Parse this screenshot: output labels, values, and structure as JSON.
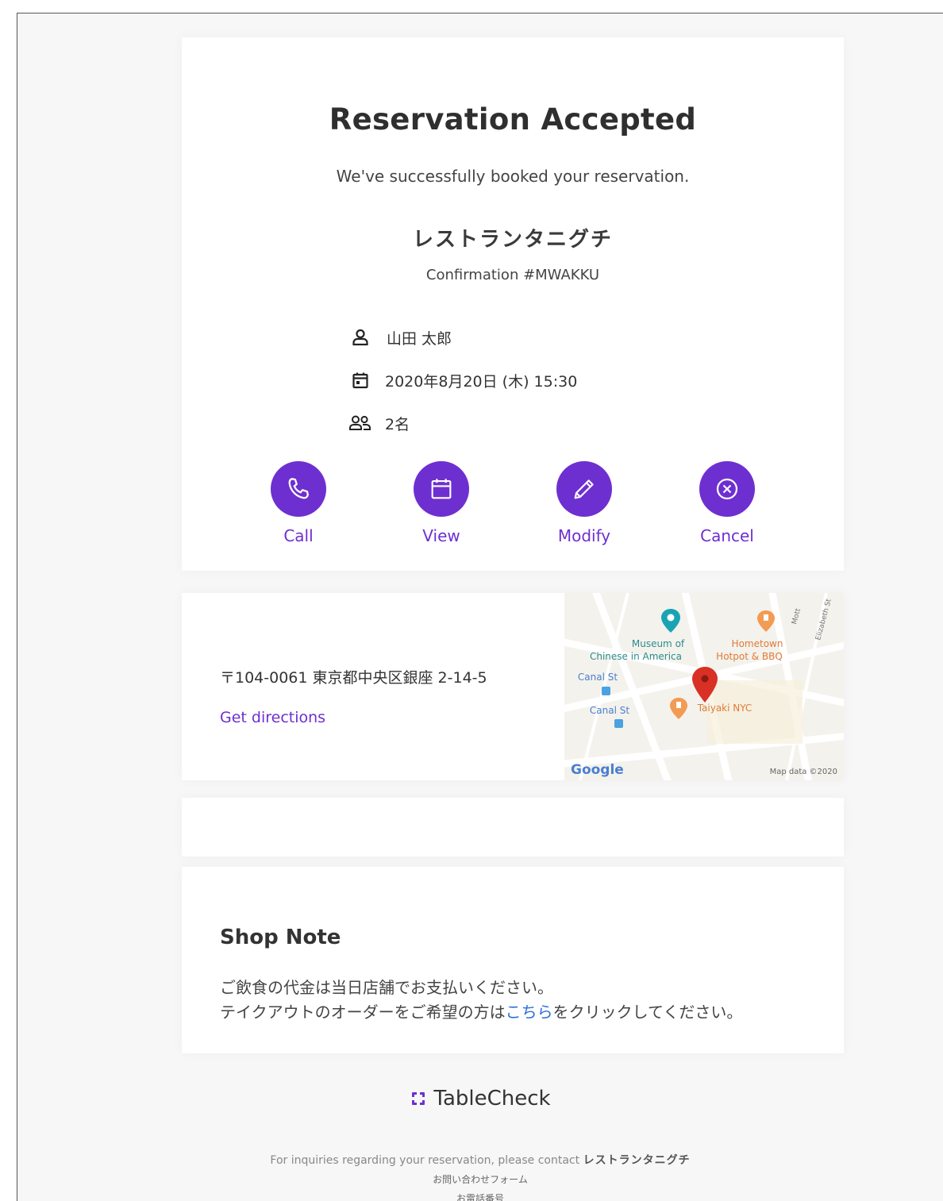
{
  "header": {
    "title": "Reservation Accepted",
    "subtitle": "We've successfully booked your reservation.",
    "restaurant_name": "レストランタニグチ",
    "confirmation": "Confirmation #MWAKKU"
  },
  "details": {
    "guest_name": "山田 太郎",
    "datetime": "2020年8月20日 (木) 15:30",
    "party_size": "2名"
  },
  "actions": [
    {
      "label": "Call",
      "icon": "phone-icon"
    },
    {
      "label": "View",
      "icon": "calendar-icon"
    },
    {
      "label": "Modify",
      "icon": "pencil-icon"
    },
    {
      "label": "Cancel",
      "icon": "close-circle-icon"
    }
  ],
  "location": {
    "address": "〒104-0061 東京都中央区銀座 2-14-5",
    "directions_label": "Get directions",
    "map": {
      "labels": {
        "museum_1": "Museum of",
        "museum_2": "Chinese in America",
        "hotpot_1": "Hometown",
        "hotpot_2": "Hotpot & BBQ",
        "canal_1": "Canal St",
        "canal_2": "Canal St",
        "taiyaki": "Taiyaki NYC",
        "mott": "Mott",
        "elizabeth": "Elizabeth St",
        "google": "Google",
        "mapdata": "Map data ©2020"
      }
    }
  },
  "shop_note": {
    "title": "Shop Note",
    "line1": "ご飲食の代金は当日店舗でお支払いください。",
    "line2_pre": "テイクアウトのオーダーをご希望の方は",
    "line2_link": "こちら",
    "line2_post": "をクリックしてください。"
  },
  "footer": {
    "brand": "TableCheck",
    "inquiry_text": "For inquiries regarding your reservation, please contact",
    "inquiry_restaurant": "レストランタニグチ",
    "contact_form": "お問い合わせフォーム",
    "phone": "お電話番号"
  },
  "colors": {
    "accent": "#6e2fd1",
    "link_blue": "#2f6fd8",
    "map_pin_red": "#d93025",
    "map_orange": "#f29b54",
    "map_teal": "#19a3b5"
  }
}
